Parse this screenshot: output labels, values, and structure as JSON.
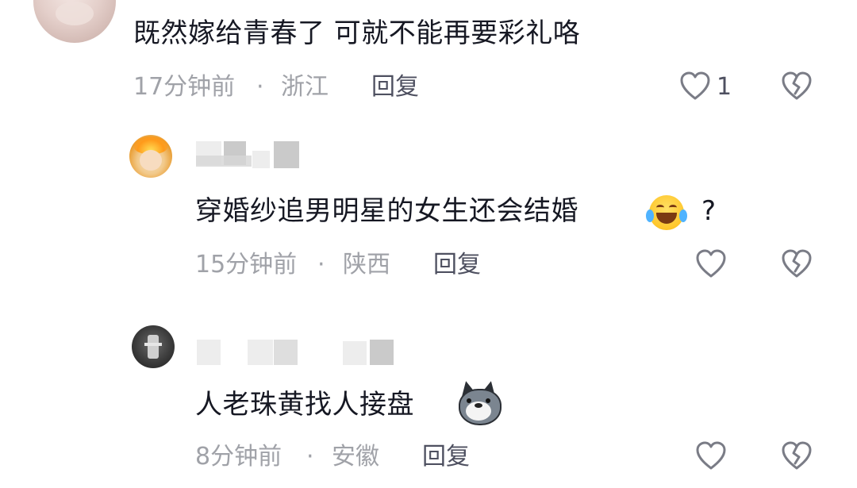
{
  "comments": [
    {
      "text": "既然嫁给青春了 可就不能再要彩礼咯",
      "time": "17分钟前",
      "sep": "·",
      "location": "浙江",
      "reply_label": "回复",
      "likes": "1"
    },
    {
      "text": "穿婚纱追男明星的女生还会结婚",
      "text_suffix": "?",
      "emoji": "laughing-tears-emoji",
      "time": "15分钟前",
      "sep": "·",
      "location": "陕西",
      "reply_label": "回复"
    },
    {
      "text": "人老珠黄找人接盘",
      "emoji": "doge-emoji",
      "time": "8分钟前",
      "sep": "·",
      "location": "安徽",
      "reply_label": "回复"
    }
  ],
  "colors": {
    "text": "#161823",
    "meta": "#a0a2a8",
    "action": "#4e5060",
    "icon": "#7a7c86"
  }
}
